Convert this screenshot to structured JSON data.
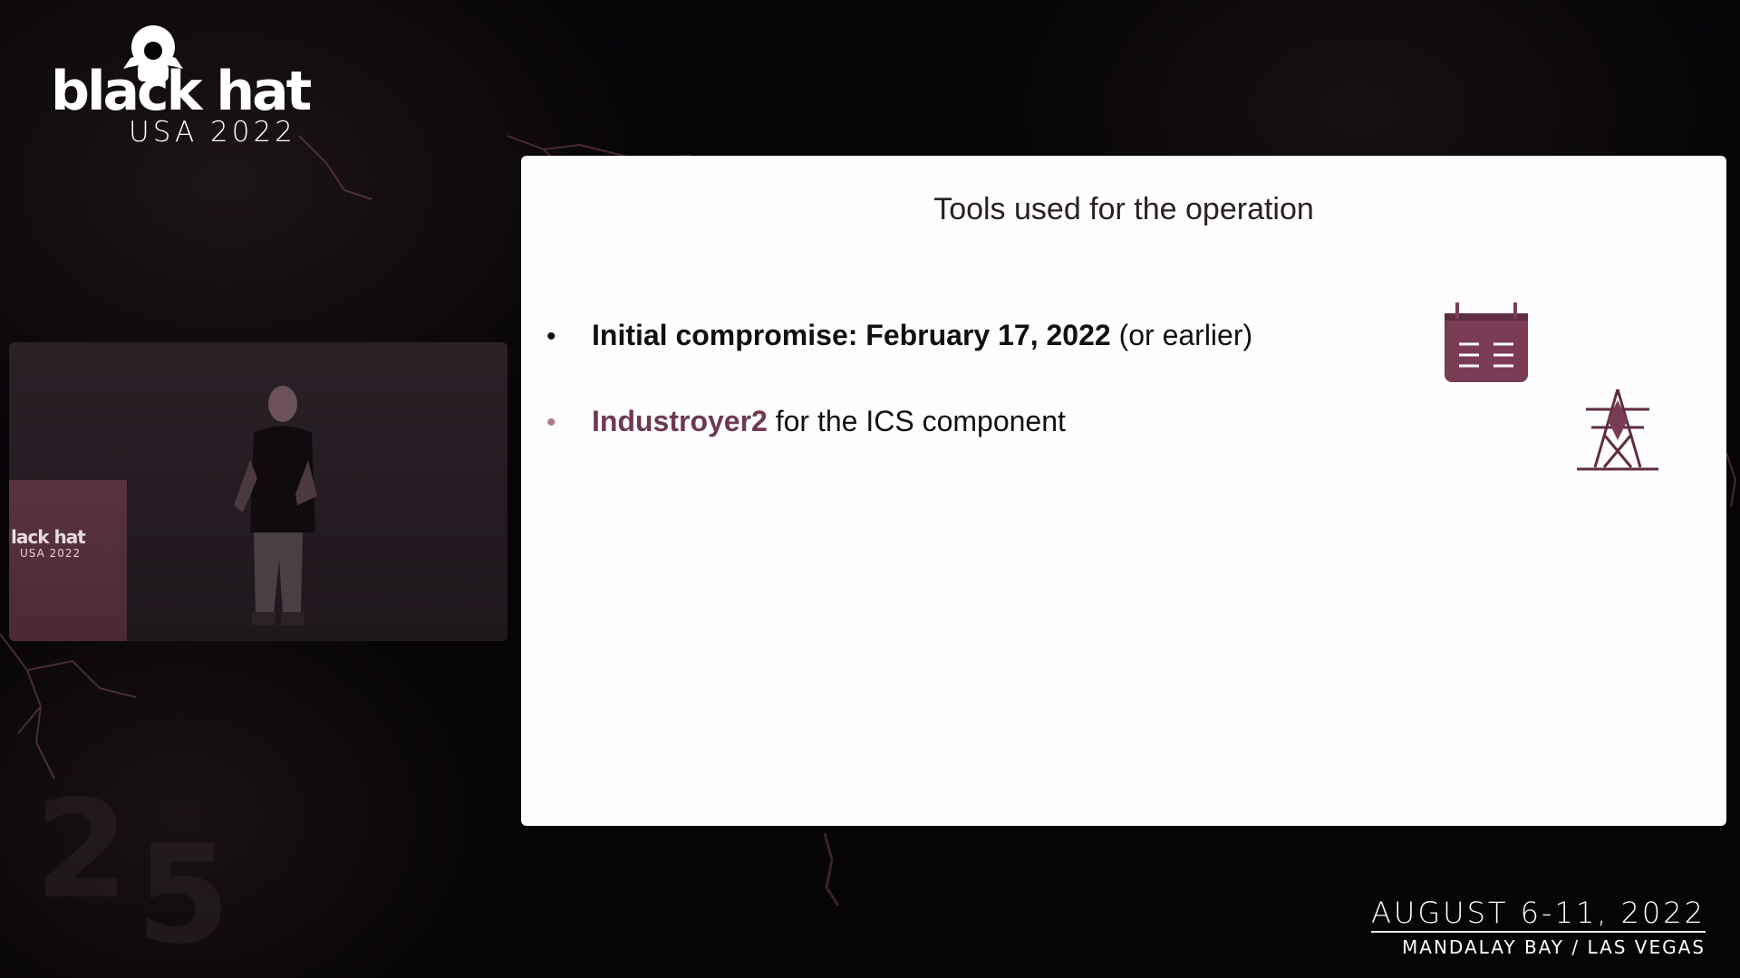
{
  "branding": {
    "name": "black hat",
    "event": "USA 2022"
  },
  "speaker_video": {
    "podium_brand": "lack hat",
    "podium_event": "USA 2022"
  },
  "slide": {
    "title": "Tools used for the operation",
    "bullets": [
      {
        "bold_text": "Initial compromise: February 17, 2022",
        "rest_text": " (or earlier)",
        "icon": "calendar-icon"
      },
      {
        "bold_text": "Industroyer2",
        "rest_text": " for the ICS component",
        "icon": "power-pylon-icon"
      }
    ],
    "bullet_symbol": "•"
  },
  "event_info": {
    "dates": "AUGUST 6-11, 2022",
    "venue": "MANDALAY BAY / LAS VEGAS"
  },
  "colors": {
    "background": "#060407",
    "slide_background": "#fdfefd",
    "accent": "#6e3a52",
    "icon_fill": "#7a3c55"
  }
}
